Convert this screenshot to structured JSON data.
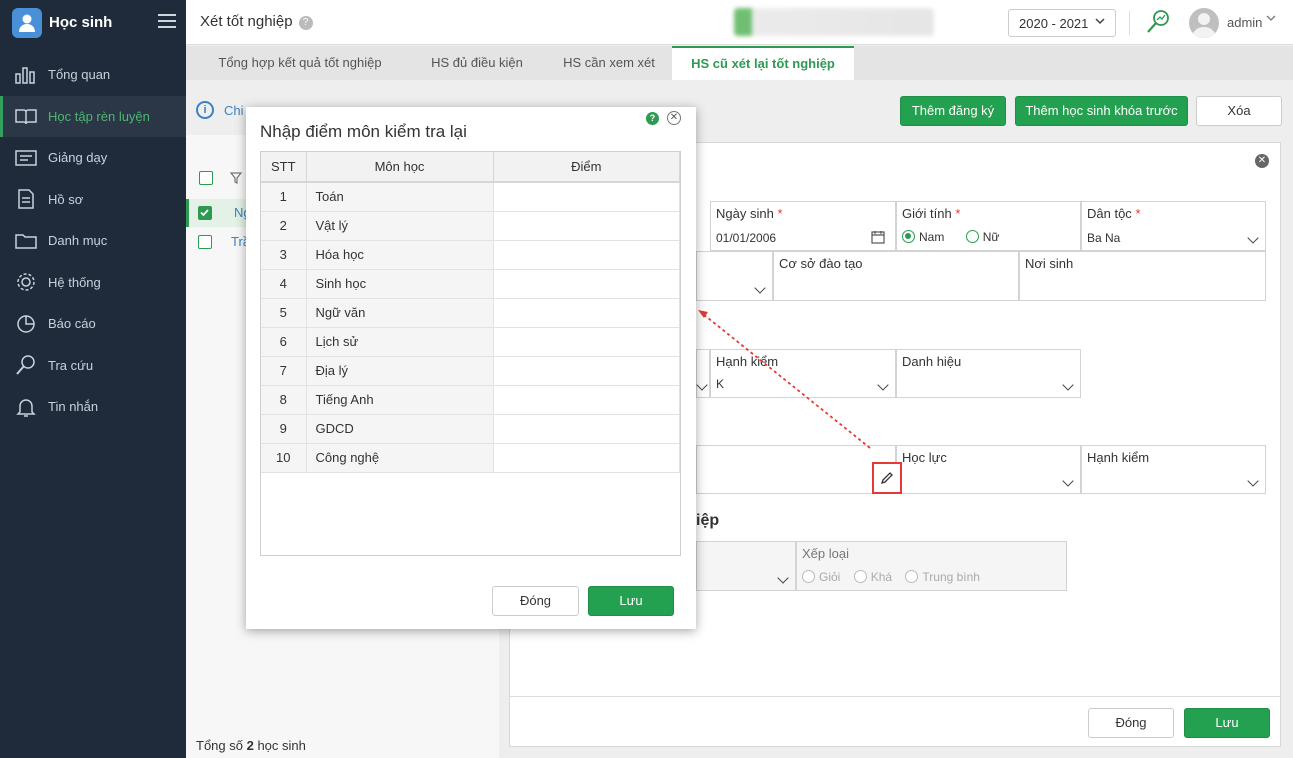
{
  "app": {
    "name": "Học sinh"
  },
  "sidebar": {
    "items": [
      {
        "label": "Tổng quan",
        "icon": "bar-chart-icon"
      },
      {
        "label": "Học tập rèn luyện",
        "icon": "book-icon",
        "active": true
      },
      {
        "label": "Giảng dạy",
        "icon": "board-icon"
      },
      {
        "label": "Hồ sơ",
        "icon": "document-icon"
      },
      {
        "label": "Danh mục",
        "icon": "folder-icon"
      },
      {
        "label": "Hệ thống",
        "icon": "gear-icon"
      },
      {
        "label": "Báo cáo",
        "icon": "pie-chart-icon"
      },
      {
        "label": "Tra cứu",
        "icon": "search-icon"
      },
      {
        "label": "Tin nhắn",
        "icon": "bell-icon"
      }
    ]
  },
  "header": {
    "title": "Xét tốt nghiệp",
    "help": "?",
    "year": "2020 - 2021",
    "user": "admin"
  },
  "tabs": [
    {
      "label": "Tổng hợp kết quả tốt nghiệp"
    },
    {
      "label": "HS đủ điều kiện"
    },
    {
      "label": "HS cần xem xét"
    },
    {
      "label": "HS cũ xét lại tốt nghiệp",
      "active": true
    }
  ],
  "toolbar": {
    "info_link": "Chi tiết",
    "add_register": "Thêm đăng ký",
    "add_prev_student": "Thêm học sinh khóa trước",
    "delete": "Xóa"
  },
  "list": {
    "rows": [
      {
        "text": "Ng",
        "checked": true
      },
      {
        "text": "Trầ",
        "checked": false
      }
    ],
    "total_prefix": "Tổng số ",
    "total_count": "2",
    "total_suffix": " học sinh"
  },
  "form": {
    "dob_label": "Ngày sinh",
    "dob_value": "01/01/2006",
    "gender_label": "Giới tính",
    "gender_male": "Nam",
    "gender_female": "Nữ",
    "ethnic_label": "Dân tộc",
    "ethnic_value": "Ba Na",
    "school_label": "Cơ sở đào tạo",
    "birthplace_label": "Nơi sinh",
    "conduct_label": "Hạnh kiểm",
    "conduct_value": "K",
    "title_label": "Danh hiệu",
    "academic_label": "Học lực",
    "conduct2_label": "Hạnh kiểm",
    "grad_section": "iệp",
    "rank_label": "Xếp loại",
    "rank_good": "Giỏi",
    "rank_fair": "Khá",
    "rank_avg": "Trung bình",
    "close": "Đóng",
    "save": "Lưu"
  },
  "dialog": {
    "title": "Nhập điểm môn kiểm tra lại",
    "col_stt": "STT",
    "col_subject": "Môn học",
    "col_score": "Điểm",
    "rows": [
      {
        "stt": "1",
        "subject": "Toán",
        "score": ""
      },
      {
        "stt": "2",
        "subject": "Vật lý",
        "score": ""
      },
      {
        "stt": "3",
        "subject": "Hóa học",
        "score": ""
      },
      {
        "stt": "4",
        "subject": "Sinh học",
        "score": ""
      },
      {
        "stt": "5",
        "subject": "Ngữ văn",
        "score": ""
      },
      {
        "stt": "6",
        "subject": "Lịch sử",
        "score": ""
      },
      {
        "stt": "7",
        "subject": "Địa lý",
        "score": ""
      },
      {
        "stt": "8",
        "subject": "Tiếng Anh",
        "score": ""
      },
      {
        "stt": "9",
        "subject": "GDCD",
        "score": ""
      },
      {
        "stt": "10",
        "subject": "Công nghệ",
        "score": ""
      }
    ],
    "close": "Đóng",
    "save": "Lưu"
  },
  "colors": {
    "sidebar_bg": "#1f2a3a",
    "accent": "#23a150",
    "link": "#3b82c4",
    "highlight": "#e53935"
  }
}
